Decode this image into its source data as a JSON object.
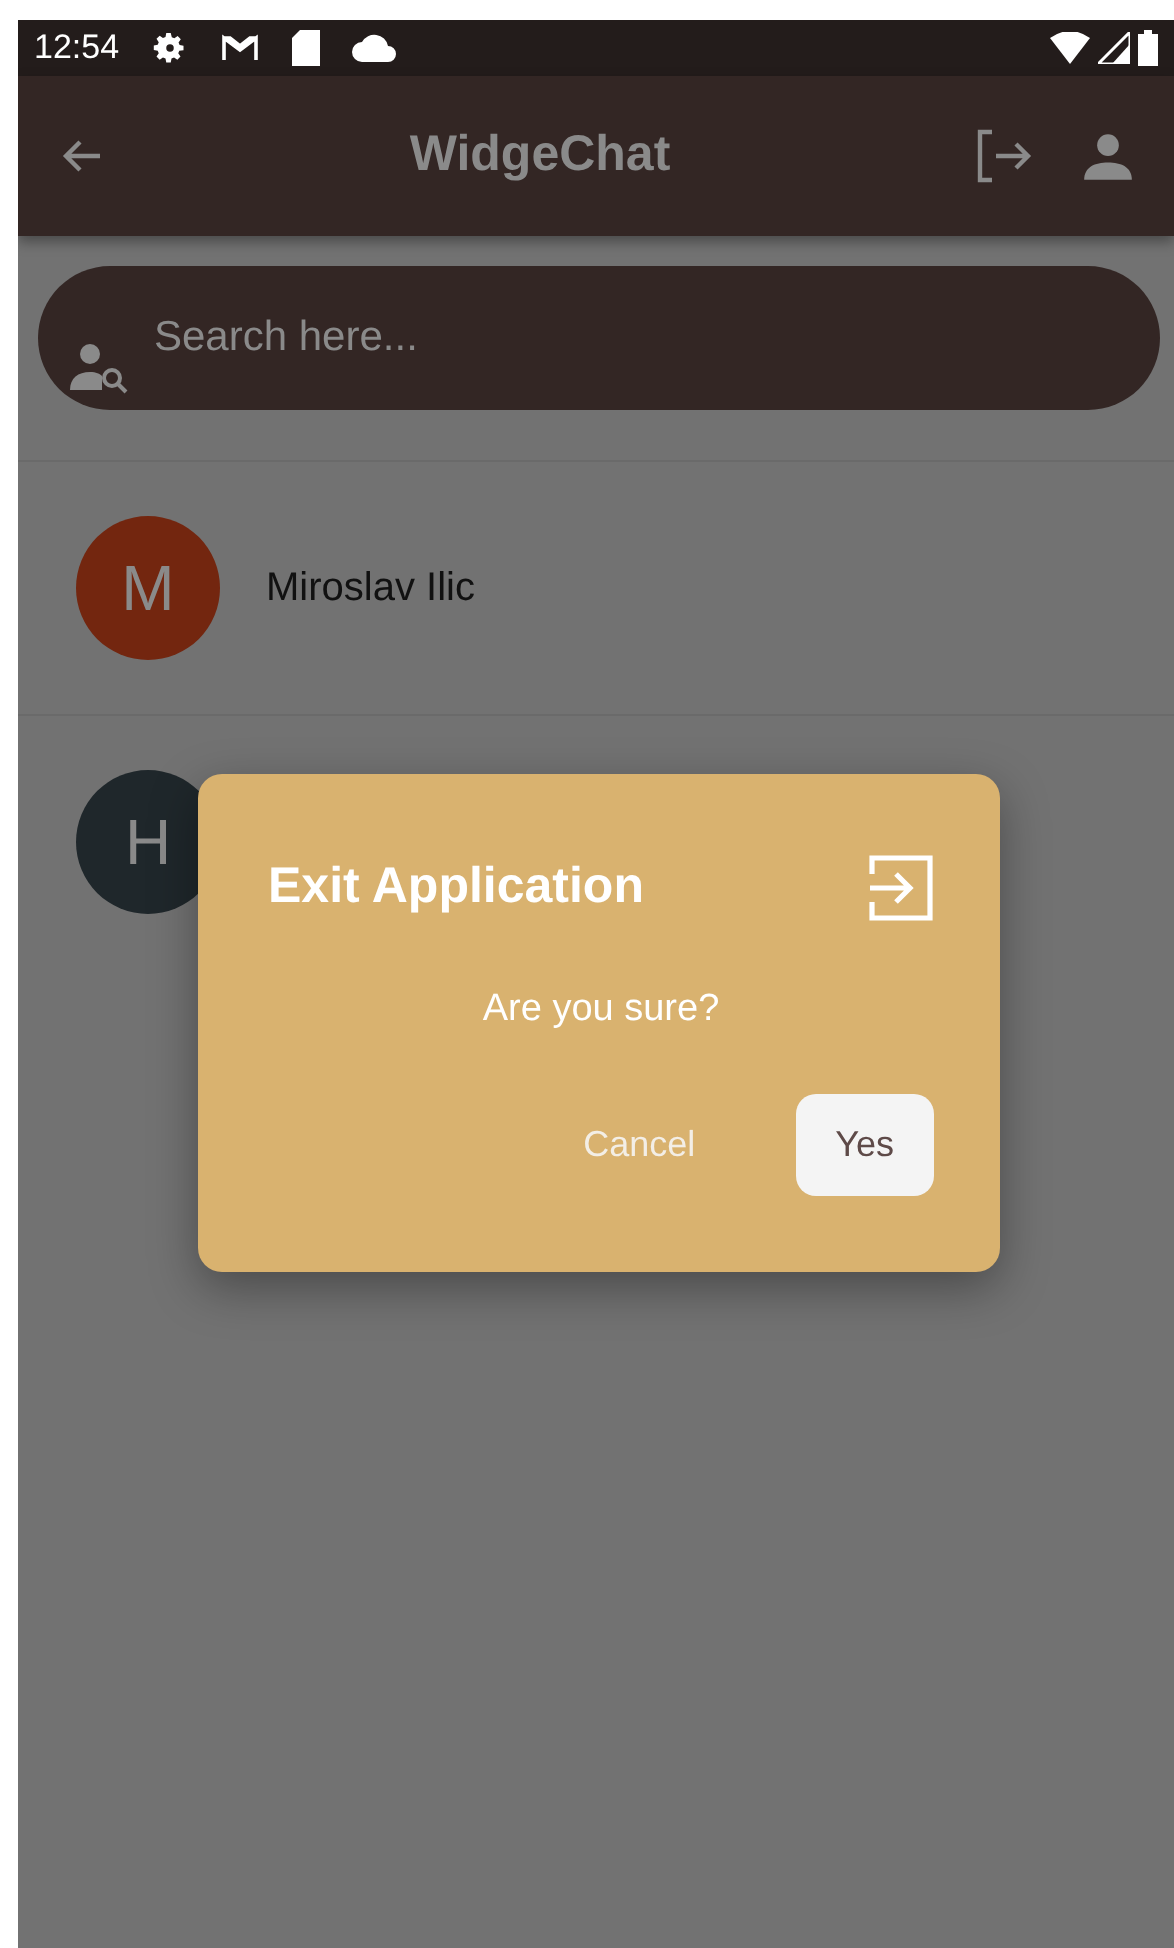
{
  "status_bar": {
    "time": "12:54"
  },
  "app_bar": {
    "title": "WidgeChat"
  },
  "search": {
    "placeholder": "Search here..."
  },
  "contacts": [
    {
      "initial": "M",
      "name": "Miroslav Ilic",
      "color": "#73260f"
    },
    {
      "initial": "H",
      "color": "#1f272b"
    }
  ],
  "dialog": {
    "title": "Exit Application",
    "message": "Are you sure?",
    "buttons": [
      {
        "label": "Cancel",
        "kind": "text"
      },
      {
        "label": "Yes",
        "kind": "filled"
      }
    ]
  }
}
